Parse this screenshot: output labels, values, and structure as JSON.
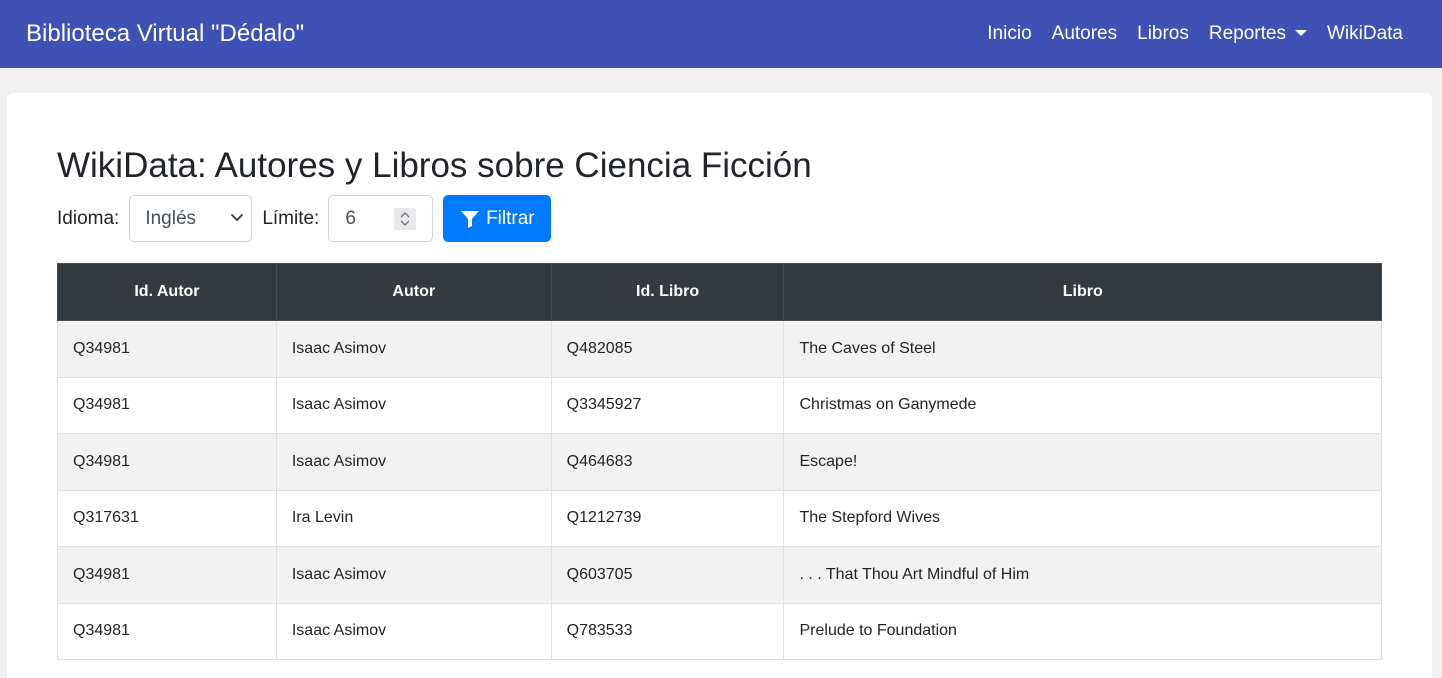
{
  "navbar": {
    "brand": "Biblioteca Virtual \"Dédalo\"",
    "items": [
      "Inicio",
      "Autores",
      "Libros",
      "Reportes",
      "WikiData"
    ]
  },
  "main": {
    "title": "WikiData: Autores y Libros sobre Ciencia Ficción",
    "idioma_label": "Idioma:",
    "idioma_value": "Inglés",
    "limite_label": "Límite:",
    "limite_value": "6",
    "filter_button": "Filtrar"
  },
  "table": {
    "headers": [
      "Id. Autor",
      "Autor",
      "Id. Libro",
      "Libro"
    ],
    "rows": [
      [
        "Q34981",
        "Isaac Asimov",
        "Q482085",
        "The Caves of Steel"
      ],
      [
        "Q34981",
        "Isaac Asimov",
        "Q3345927",
        "Christmas on Ganymede"
      ],
      [
        "Q34981",
        "Isaac Asimov",
        "Q464683",
        "Escape!"
      ],
      [
        "Q317631",
        "Ira Levin",
        "Q1212739",
        "The Stepford Wives"
      ],
      [
        "Q34981",
        "Isaac Asimov",
        "Q603705",
        ". . . That Thou Art Mindful of Him"
      ],
      [
        "Q34981",
        "Isaac Asimov",
        "Q783533",
        "Prelude to Foundation"
      ]
    ]
  },
  "colors": {
    "navbar": "#3f51b5",
    "primary_button": "#007bff",
    "table_header": "#343a40"
  },
  "icons": {
    "dropdown": "caret-down-icon",
    "select": "chevron-down-icon",
    "filter": "filter-icon"
  }
}
